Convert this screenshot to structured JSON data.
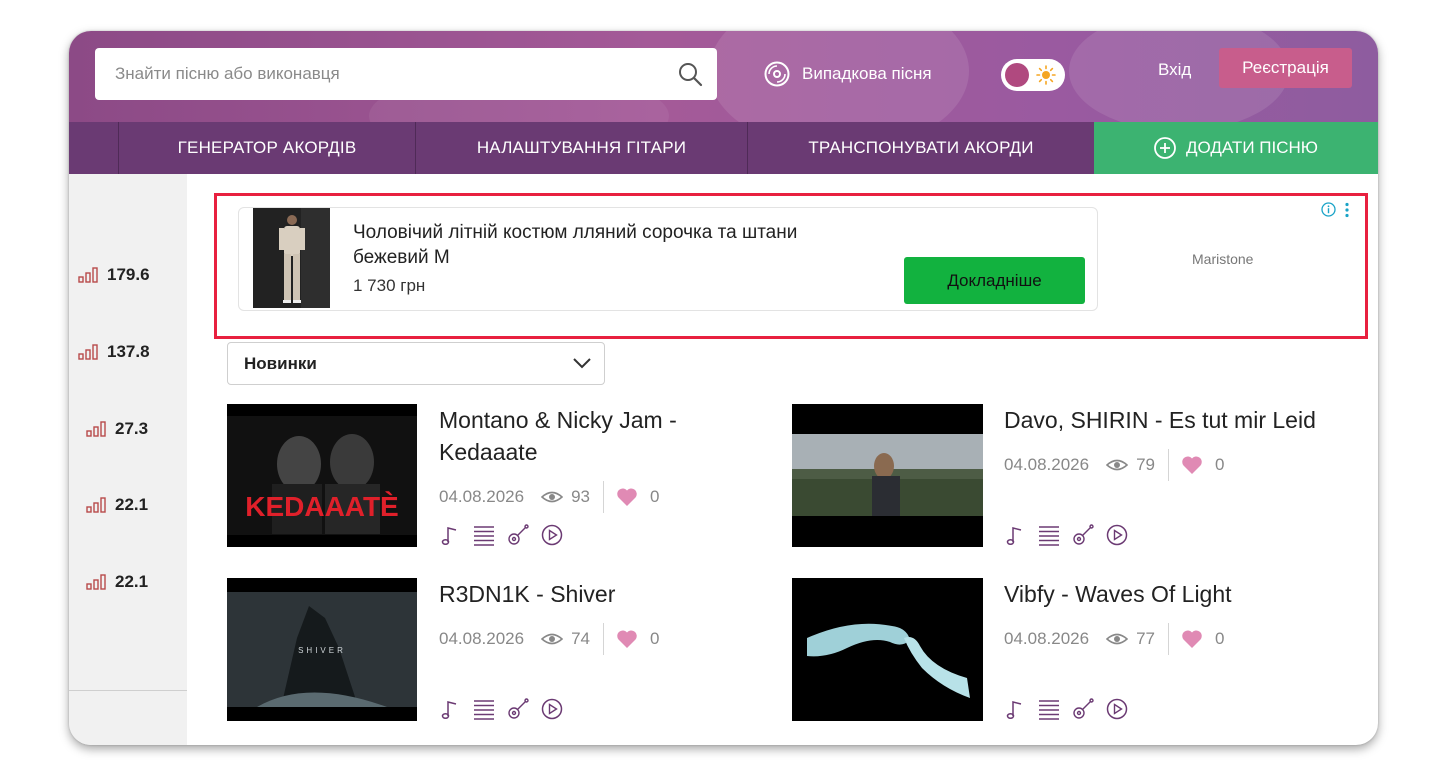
{
  "header": {
    "search_placeholder": "Знайти пісню або виконавця",
    "random_song": "Випадкова пісня",
    "login": "Вхід",
    "register": "Реєстрація"
  },
  "nav": {
    "items": [
      "ГЕНЕРАТОР АКОРДІВ",
      "НАЛАШТУВАННЯ ГІТАРИ",
      "ТРАНСПОНУВАТИ АКОРДИ"
    ],
    "add_song": "ДОДАТИ ПІСНЮ"
  },
  "sidebar": {
    "stats": [
      "179.6",
      "137.8",
      "27.3",
      "22.1",
      "22.1"
    ]
  },
  "ad": {
    "title": "Чоловічий літній костюм лляний сорочка та штани бежевий M",
    "price": "1 730 грн",
    "button": "Докладніше",
    "brand": "Maristone"
  },
  "sort": {
    "selected": "Новинки"
  },
  "songs": [
    {
      "title": "Montano & Nicky Jam - Kedaaate",
      "date": "04.08.2026",
      "views": "93",
      "likes": "0",
      "cover_text": "KEDAAATÈ"
    },
    {
      "title": "Davo, SHIRIN - Es tut mir Leid",
      "date": "04.08.2026",
      "views": "79",
      "likes": "0"
    },
    {
      "title": "R3DN1K - Shiver",
      "date": "04.08.2026",
      "views": "74",
      "likes": "0",
      "cover_text": "SHIVER"
    },
    {
      "title": "Vibfy - Waves Of Light",
      "date": "04.08.2026",
      "views": "77",
      "likes": "0"
    }
  ],
  "colors": {
    "nav_bg": "#6a3a73",
    "add_song_bg": "#3cb371",
    "register_bg": "#c85d8c",
    "ad_button": "#12b23f",
    "ad_border": "#e8203f",
    "accent": "#7a3a78"
  }
}
